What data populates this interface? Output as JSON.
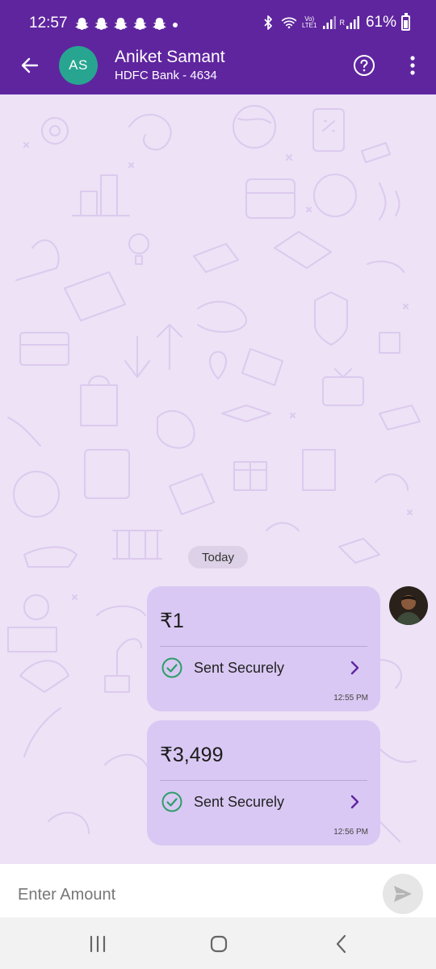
{
  "status_bar": {
    "time": "12:57",
    "volte_top": "Vo)",
    "volte_bottom": "LTE1",
    "signal_label": "R",
    "battery_percent": "61%",
    "battery_level": 0.61,
    "icons": [
      "snapchat-icon",
      "bluetooth-icon",
      "wifi-icon",
      "signal-icon",
      "battery-icon"
    ]
  },
  "header": {
    "avatar_initials": "AS",
    "contact_name": "Aniket Samant",
    "contact_subtitle": "HDFC Bank - 4634",
    "icons": [
      "back-arrow-icon",
      "help-icon",
      "more-vertical-icon"
    ]
  },
  "chat": {
    "date_label": "Today",
    "messages": [
      {
        "amount": "₹1",
        "status": "Sent Securely",
        "time": "12:55 PM"
      },
      {
        "amount": "₹3,499",
        "status": "Sent Securely",
        "time": "12:56 PM"
      }
    ]
  },
  "input": {
    "placeholder": "Enter Amount",
    "value": ""
  },
  "colors": {
    "brand": "#5f259f",
    "chat_bg": "#ede2f6",
    "bubble": "#d9c8f3",
    "avatar": "#27a590",
    "success": "#2e9d6a"
  }
}
